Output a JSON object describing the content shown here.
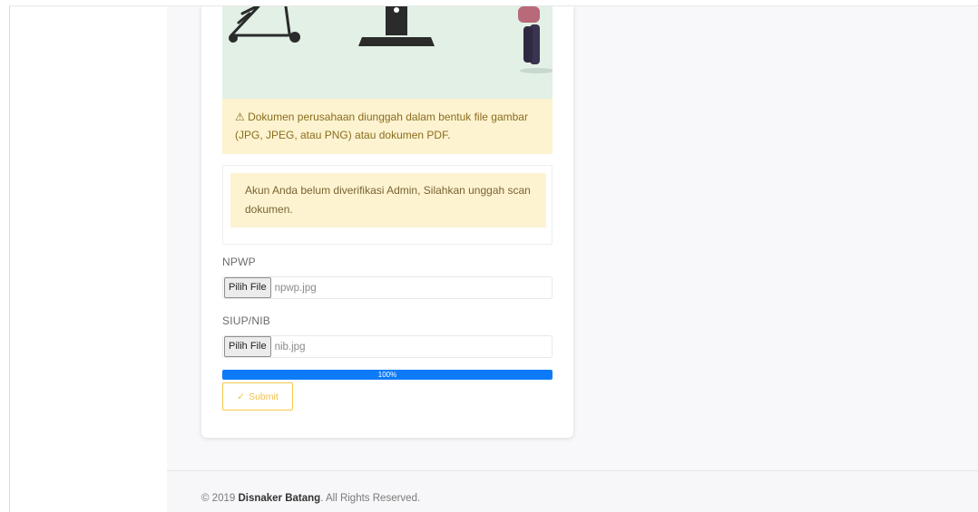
{
  "alerts": {
    "upload_info": "⚠ Dokumen perusahaan diunggah dalam bentuk file gambar (JPG, JPEG, atau PNG) atau dokumen PDF.",
    "verification": "Akun Anda belum diverifikasi Admin, Silahkan unggah scan dokumen."
  },
  "form": {
    "npwp": {
      "label": "NPWP",
      "button": "Pilih File",
      "filename": "npwp.jpg"
    },
    "siup": {
      "label": "SIUP/NIB",
      "button": "Pilih File",
      "filename": "nib.jpg"
    },
    "progress": {
      "label": "100%",
      "value": 100
    },
    "submit": {
      "icon": "✓",
      "label": "Submit"
    }
  },
  "footer": {
    "prefix": "© 2019 ",
    "company": "Disnaker Batang",
    "suffix": ". All Rights Reserved."
  },
  "colors": {
    "alert_bg": "#fdf3d0",
    "progress": "#0d7bf8",
    "submit_border": "#f6c74a",
    "illustration_bg": "#e2f0e6"
  }
}
